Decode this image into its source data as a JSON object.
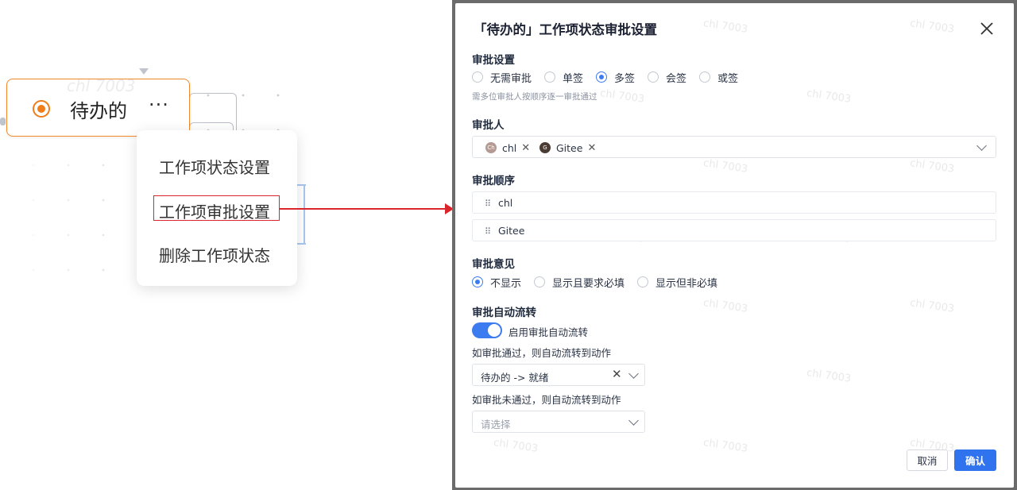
{
  "canvas": {
    "node_label": "待办的",
    "node_more": "···",
    "watermark": "chl 7003",
    "menu": {
      "items": [
        "工作项状态设置",
        "工作项审批设置",
        "删除工作项状态"
      ],
      "highlighted_index": 1
    }
  },
  "modal": {
    "title": "「待办的」工作项状态审批设置",
    "watermark": "chl 7003",
    "approval_settings": {
      "label": "审批设置",
      "options": [
        "无需审批",
        "单签",
        "多签",
        "会签",
        "或签"
      ],
      "selected": "多签",
      "hint": "需多位审批人按顺序逐一审批通过"
    },
    "approvers": {
      "label": "审批人",
      "tags": [
        {
          "avatar": "Ch",
          "name": "chl"
        },
        {
          "avatar": "G",
          "name": "Gitee"
        }
      ]
    },
    "approval_order": {
      "label": "审批顺序",
      "items": [
        "chl",
        "Gitee"
      ]
    },
    "approval_opinion": {
      "label": "审批意见",
      "options": [
        "不显示",
        "显示且要求必填",
        "显示但非必填"
      ],
      "selected": "不显示"
    },
    "auto_flow": {
      "label": "审批自动流转",
      "toggle_label": "启用审批自动流转",
      "toggle_on": true,
      "pass_label": "如审批通过，则自动流转到动作",
      "pass_value": "待办的 -> 就绪",
      "fail_label": "如审批未通过，则自动流转到动作",
      "fail_placeholder": "请选择"
    },
    "buttons": {
      "cancel": "取消",
      "confirm": "确认"
    }
  },
  "colors": {
    "accent": "#2f74ee",
    "node_orange": "#f07d1a",
    "highlight_red": "#d9262c"
  }
}
